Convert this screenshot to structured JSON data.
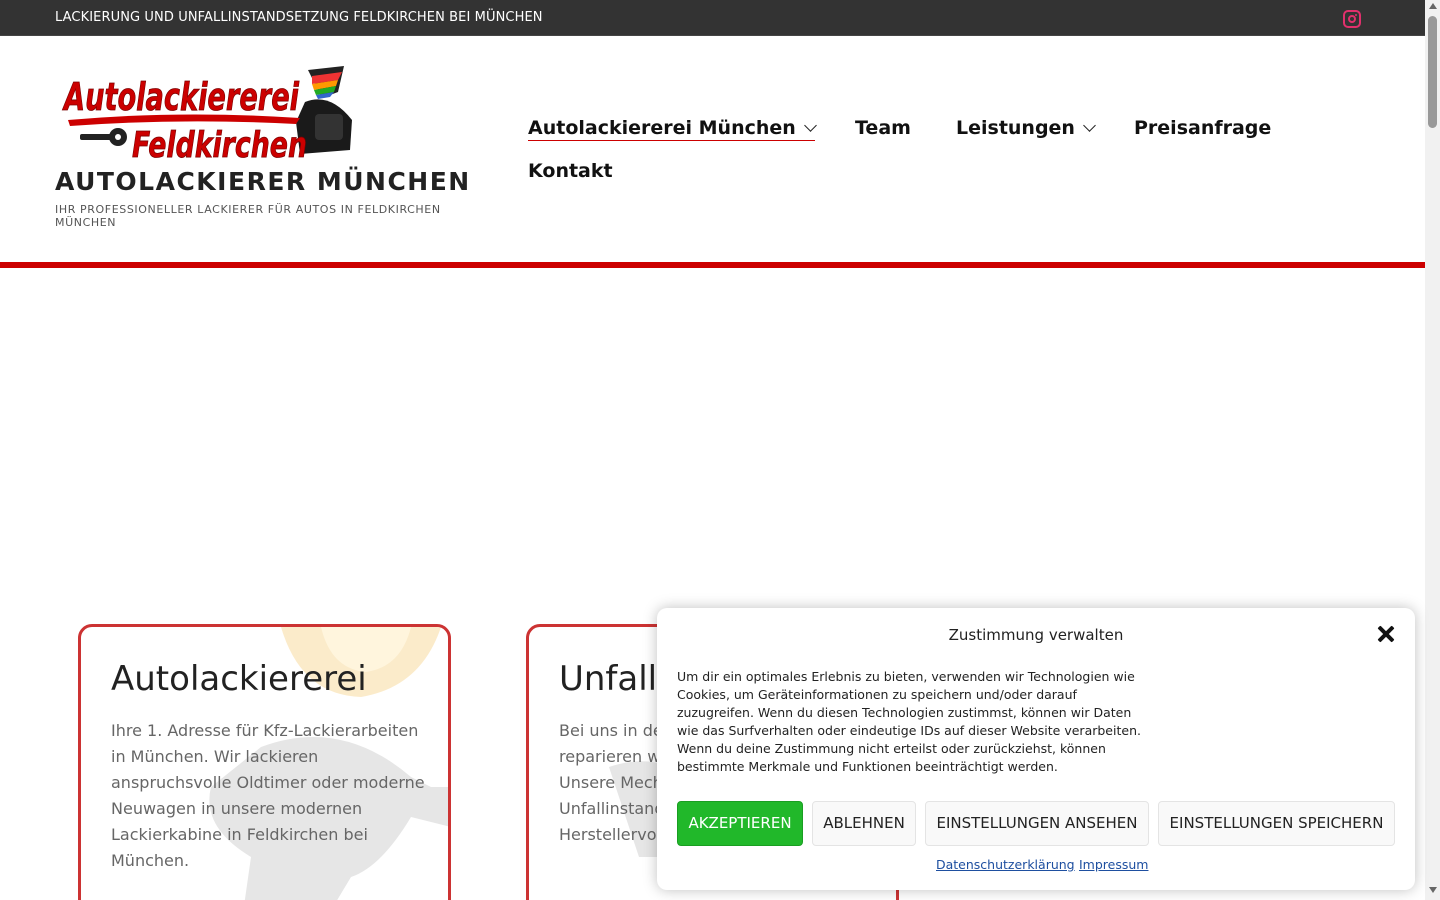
{
  "topbar": {
    "text": "LACKIERUNG UND UNFALLINSTANDSETZUNG FELDKIRCHEN BEI MÜNCHEN",
    "icon": "instagram-icon"
  },
  "header": {
    "logo_line1": "Autolackiererei",
    "logo_line2": "Feldkirchen",
    "title": "AUTOLACKIERER MÜNCHEN",
    "tagline": "IHR PROFESSIONELLER LACKIERER FÜR AUTOS IN FELDKIRCHEN MÜNCHEN"
  },
  "nav": {
    "items": [
      {
        "label": "Autolackiererei München"
      },
      {
        "label": "Team"
      },
      {
        "label": "Leistungen"
      },
      {
        "label": "Preisanfrage"
      },
      {
        "label": "Kontakt"
      }
    ]
  },
  "cards": [
    {
      "title": "Autolackiererei",
      "text": "Ihre 1. Adresse für Kfz-Lackierarbeiten in München. Wir lackieren anspruchsvolle Oldtimer oder moderne Neuwagen in unsere modernen Lackierkabine in Feldkirchen bei München."
    },
    {
      "title": "Unfall",
      "text": "Bei uns in de reparieren w Unsere Mech Unfallinstand Herstellervo"
    }
  ],
  "consent": {
    "title": "Zustimmung verwalten",
    "text": "Um dir ein optimales Erlebnis zu bieten, verwenden wir Technologien wie Cookies, um Geräteinformationen zu speichern und/oder darauf zuzugreifen. Wenn du diesen Technologien zustimmst, können wir Daten wie das Surfverhalten oder eindeutige IDs auf dieser Website verarbeiten. Wenn du deine Zustimmung nicht erteilst oder zurückziehst, können bestimmte Merkmale und Funktionen beeinträchtigt werden.",
    "buttons": {
      "accept": "AKZEPTIEREN",
      "deny": "ABLEHNEN",
      "view": "EINSTELLUNGEN ANSEHEN",
      "save": "EINSTELLUNGEN SPEICHERN"
    },
    "links": {
      "privacy": "Datenschutzerklärung",
      "imprint": "Impressum"
    }
  },
  "colors": {
    "accent": "#cc0000",
    "accept": "#21b82a",
    "topbar": "#333333"
  }
}
